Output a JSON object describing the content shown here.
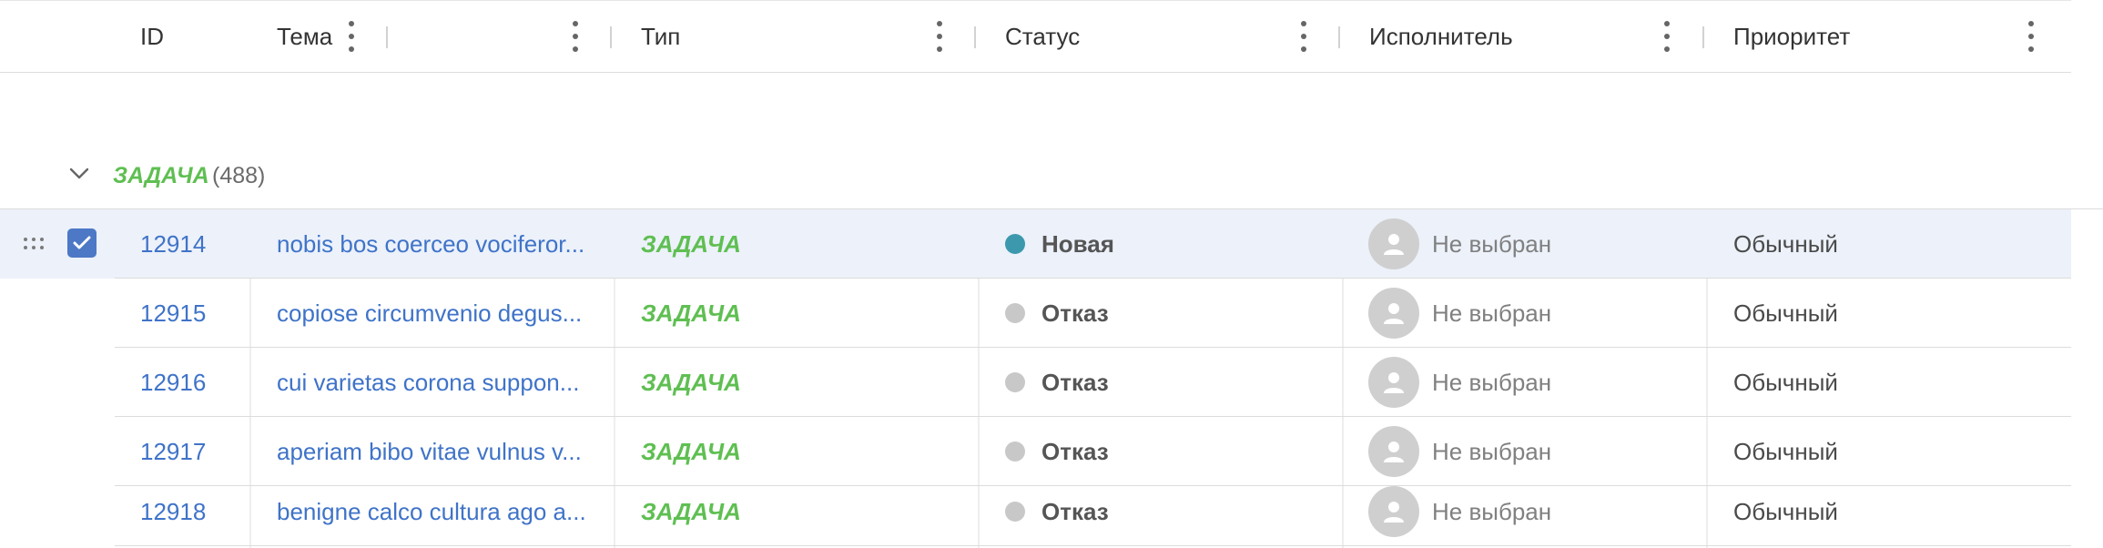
{
  "columns": [
    {
      "label": "ID"
    },
    {
      "label": "Тема"
    },
    {
      "label": "Тип"
    },
    {
      "label": "Статус"
    },
    {
      "label": "Исполнитель"
    },
    {
      "label": "Приоритет"
    }
  ],
  "group": {
    "name": "ЗАДАЧА",
    "count": "(488)"
  },
  "rows": [
    {
      "id": "12914",
      "topic": "nobis bos coerceo vociferor...",
      "type": "ЗАДАЧА",
      "status": "Новая",
      "status_color": "#3c99ad",
      "assignee": "Не выбран",
      "priority": "Обычный",
      "selected": true
    },
    {
      "id": "12915",
      "topic": "copiose circumvenio degus...",
      "type": "ЗАДАЧА",
      "status": "Отказ",
      "status_color": "#c8c8c8",
      "assignee": "Не выбран",
      "priority": "Обычный",
      "selected": false
    },
    {
      "id": "12916",
      "topic": "cui varietas corona suppon...",
      "type": "ЗАДАЧА",
      "status": "Отказ",
      "status_color": "#c8c8c8",
      "assignee": "Не выбран",
      "priority": "Обычный",
      "selected": false
    },
    {
      "id": "12917",
      "topic": "aperiam bibo vitae vulnus v...",
      "type": "ЗАДАЧА",
      "status": "Отказ",
      "status_color": "#c8c8c8",
      "assignee": "Не выбран",
      "priority": "Обычный",
      "selected": false
    },
    {
      "id": "12918",
      "topic": "benigne calco cultura ago a...",
      "type": "ЗАДАЧА",
      "status": "Отказ",
      "status_color": "#c8c8c8",
      "assignee": "Не выбран",
      "priority": "Обычный",
      "selected": false
    }
  ],
  "colors": {
    "link": "#3f73c8",
    "type_green": "#5fbf52",
    "selected_bg": "#ecf1fa",
    "checkbox": "#4d78c6"
  },
  "icons": {
    "column_menu": "kebab-icon",
    "group_toggle": "chevron-down-icon",
    "drag": "drag-handle-icon",
    "avatar": "user-avatar-icon"
  }
}
